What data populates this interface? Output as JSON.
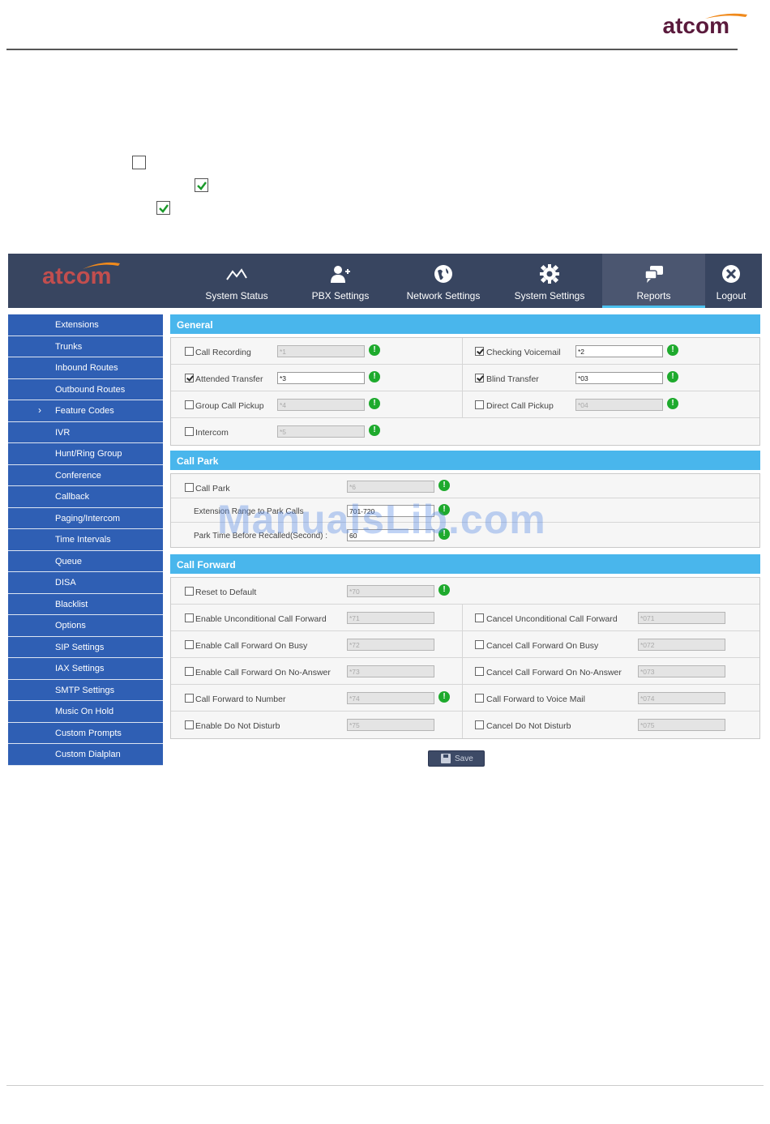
{
  "document": {
    "logo_text": "atcom",
    "checkboxes": [
      false,
      true,
      true
    ]
  },
  "app": {
    "brand": "atcom",
    "nav": [
      {
        "label": "System Status",
        "icon": "status-chart-icon",
        "active": false
      },
      {
        "label": "PBX Settings",
        "icon": "user-add-icon",
        "active": false
      },
      {
        "label": "Network Settings",
        "icon": "globe-icon",
        "active": false
      },
      {
        "label": "System Settings",
        "icon": "gear-icon",
        "active": false
      },
      {
        "label": "Reports",
        "icon": "chat-bubbles-icon",
        "active": true
      },
      {
        "label": "Logout",
        "icon": "close-circle-icon",
        "active": false
      }
    ],
    "sidebar": [
      {
        "label": "Extensions"
      },
      {
        "label": "Trunks"
      },
      {
        "label": "Inbound Routes"
      },
      {
        "label": "Outbound Routes"
      },
      {
        "label": "Feature Codes",
        "current": true
      },
      {
        "label": "IVR"
      },
      {
        "label": "Hunt/Ring Group"
      },
      {
        "label": "Conference"
      },
      {
        "label": "Callback"
      },
      {
        "label": "Paging/Intercom"
      },
      {
        "label": "Time Intervals"
      },
      {
        "label": "Queue"
      },
      {
        "label": "DISA"
      },
      {
        "label": "Blacklist"
      },
      {
        "label": "Options"
      },
      {
        "label": "SIP Settings"
      },
      {
        "label": "IAX Settings"
      },
      {
        "label": "SMTP Settings"
      },
      {
        "label": "Music On Hold"
      },
      {
        "label": "Custom Prompts"
      },
      {
        "label": "Custom Dialplan"
      }
    ],
    "general": {
      "title": "General",
      "call_recording": {
        "label": "Call Recording",
        "value": "*1",
        "checked": false
      },
      "checking_voicemail": {
        "label": "Checking Voicemail",
        "value": "*2",
        "checked": true
      },
      "attended_transfer": {
        "label": "Attended Transfer",
        "value": "*3",
        "checked": true
      },
      "blind_transfer": {
        "label": "Blind Transfer",
        "value": "*03",
        "checked": true
      },
      "group_call_pickup": {
        "label": "Group Call Pickup",
        "value": "*4",
        "checked": false
      },
      "direct_call_pickup": {
        "label": "Direct Call Pickup",
        "value": "*04",
        "checked": false
      },
      "intercom": {
        "label": "Intercom",
        "value": "*5",
        "checked": false
      }
    },
    "call_park": {
      "title": "Call Park",
      "call_park": {
        "label": "Call Park",
        "value": "*6",
        "checked": false
      },
      "ext_range": {
        "label": "Extension Range to Park Calls",
        "value": "701-720"
      },
      "park_time": {
        "label": "Park Time Before Recalled(Second) :",
        "value": "60"
      }
    },
    "call_forward": {
      "title": "Call Forward",
      "reset_default": {
        "label": "Reset to Default",
        "value": "*70"
      },
      "enable_uncond": {
        "label": "Enable Unconditional Call Forward",
        "value": "*71"
      },
      "cancel_uncond": {
        "label": "Cancel Unconditional Call Forward",
        "value": "*071"
      },
      "enable_busy": {
        "label": "Enable Call Forward On Busy",
        "value": "*72"
      },
      "cancel_busy": {
        "label": "Cancel Call Forward On Busy",
        "value": "*072"
      },
      "enable_noanswer": {
        "label": "Enable Call Forward On No-Answer",
        "value": "*73"
      },
      "cancel_noanswer": {
        "label": "Cancel Call Forward On No-Answer",
        "value": "*073"
      },
      "fwd_number": {
        "label": "Call Forward to Number",
        "value": "*74"
      },
      "fwd_voicemail": {
        "label": "Call Forward to Voice Mail",
        "value": "*074"
      },
      "enable_dnd": {
        "label": "Enable Do Not Disturb",
        "value": "*75"
      },
      "cancel_dnd": {
        "label": "Cancel Do Not Disturb",
        "value": "*075"
      }
    },
    "save_label": "Save"
  },
  "watermark": "ManualsLib.com",
  "colors": {
    "topbar": "#384560",
    "sidebar": "#2f5fb4",
    "section_header": "#49b6ec",
    "info_icon": "#1eaa2d",
    "brand_dark": "#5a1a3c",
    "brand_light": "#c24e4e"
  }
}
